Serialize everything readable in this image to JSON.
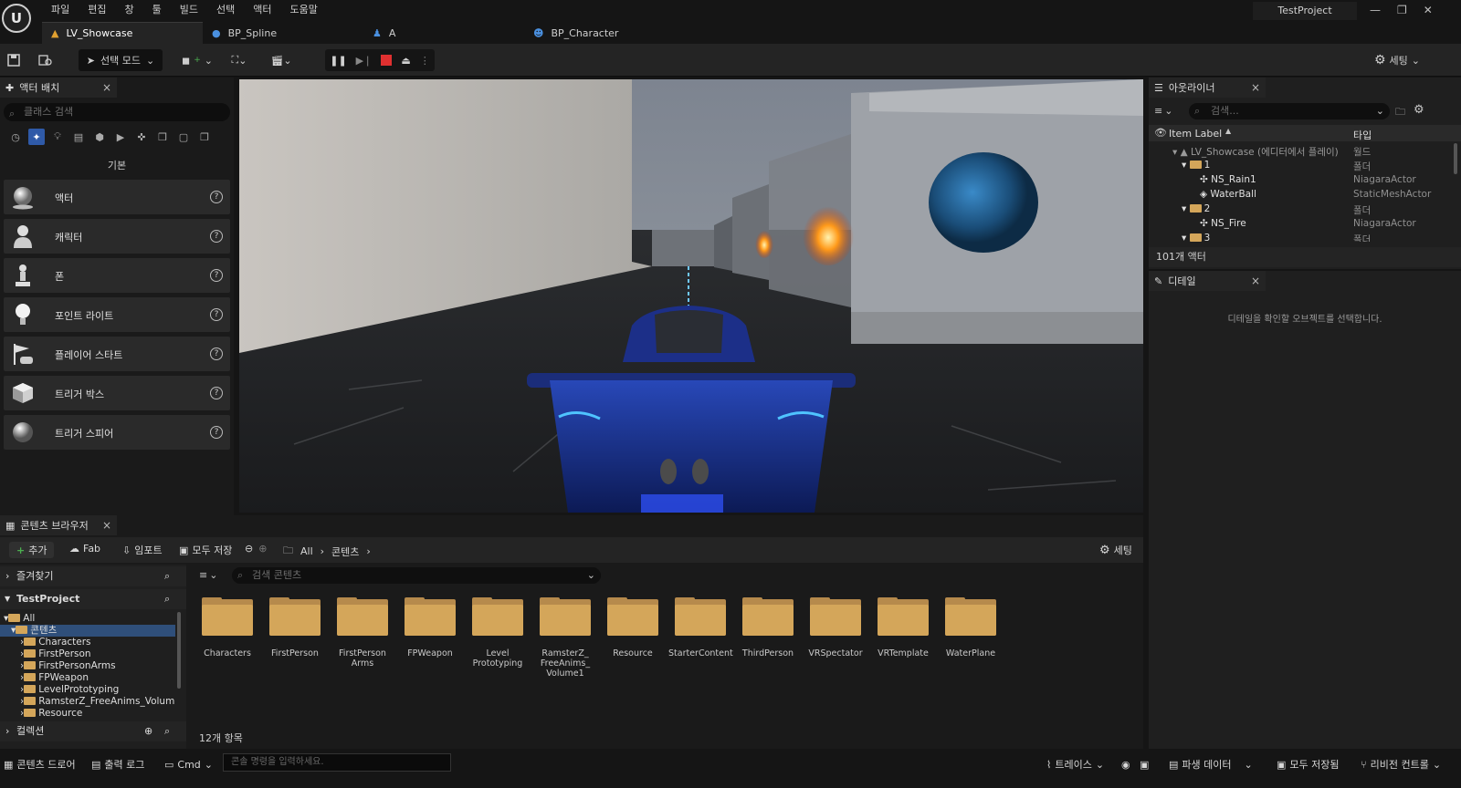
{
  "menu": [
    "파일",
    "편집",
    "창",
    "툴",
    "빌드",
    "선택",
    "액터",
    "도움말"
  ],
  "project_name": "TestProject",
  "level_tabs": [
    {
      "label": "LV_Showcase",
      "icon": "level-icon"
    },
    {
      "label": "BP_Spline",
      "icon": "blueprint-icon"
    },
    {
      "label": "A",
      "icon": "pawn-icon"
    },
    {
      "label": "BP_Character",
      "icon": "character-icon"
    }
  ],
  "toolbar": {
    "mode_label": "선택 모드",
    "settings_label": "세팅"
  },
  "place_actors": {
    "tab_label": "액터 배치",
    "search_placeholder": "클래스 검색",
    "category_label": "기본",
    "items": [
      "액터",
      "캐릭터",
      "폰",
      "포인트 라이트",
      "플레이어 스타트",
      "트리거 박스",
      "트리거 스피어"
    ]
  },
  "outliner": {
    "tab_label": "아웃라이너",
    "search_placeholder": "검색...",
    "col_label": "Item Label",
    "col_type": "타입",
    "rows": [
      {
        "name": "LV_Showcase (에디터에서 플레이)",
        "type": "월드"
      },
      {
        "name": "1",
        "type": "폴더"
      },
      {
        "name": "NS_Rain1",
        "type": "NiagaraActor"
      },
      {
        "name": "WaterBall",
        "type": "StaticMeshActor"
      },
      {
        "name": "2",
        "type": "폴더"
      },
      {
        "name": "NS_Fire",
        "type": "NiagaraActor"
      },
      {
        "name": "3",
        "type": "폴더"
      }
    ],
    "actor_count": "101개 액터"
  },
  "details": {
    "tab_label": "디테일",
    "empty_message": "디테일을 확인할 오브젝트를 선택합니다."
  },
  "content_browser": {
    "tab_label": "콘텐츠 브라우저",
    "add_label": "추가",
    "fab_label": "Fab",
    "import_label": "임포트",
    "save_all_label": "모두 저장",
    "path": [
      "All",
      "콘텐츠"
    ],
    "settings_label": "세팅",
    "favorites_label": "즐겨찾기",
    "project_label": "TestProject",
    "collections_label": "컬렉션",
    "tree": [
      "All",
      "콘텐츠",
      "Characters",
      "FirstPerson",
      "FirstPersonArms",
      "FPWeapon",
      "LevelPrototyping",
      "RamsterZ_FreeAnims_Volume",
      "Resource"
    ],
    "search_placeholder": "검색 콘텐츠",
    "folders": [
      "Characters",
      "FirstPerson",
      "FirstPerson\nArms",
      "FPWeapon",
      "Level\nPrototyping",
      "RamsterZ_\nFreeAnims_\nVolume1",
      "Resource",
      "StarterContent",
      "ThirdPerson",
      "VRSpectator",
      "VRTemplate",
      "WaterPlane"
    ],
    "item_count": "12개 항목"
  },
  "statusbar": {
    "content_drawer": "콘텐츠 드로어",
    "output_log": "출력 로그",
    "cmd": "Cmd",
    "console_placeholder": "콘솔 명령을 입력하세요.",
    "trace": "트레이스",
    "derived_data": "파생 데이터",
    "save_all": "모두 저장됨",
    "revision_control": "리비전 컨트롤"
  },
  "colors": {
    "accent": "#2f5aa8",
    "folder": "#d4a65a",
    "stop": "#e03030"
  }
}
